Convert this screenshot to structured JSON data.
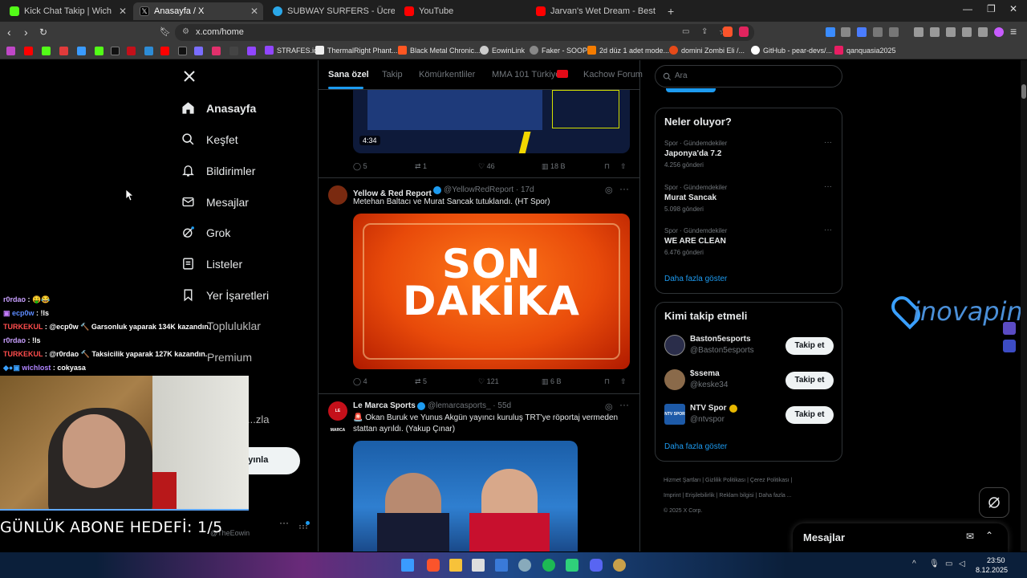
{
  "browser": {
    "tabs": [
      {
        "label": "Kick Chat Takip | Wich",
        "color": "#53fc18",
        "active": false
      },
      {
        "label": "Anasayfa / X",
        "color": "#000000",
        "active": true
      },
      {
        "label": "SUBWAY SURFERS - Ücretsiz Online C",
        "color": "#2aa7e8",
        "active": false
      },
      {
        "label": "YouTube",
        "color": "#ff0000",
        "active": false
      },
      {
        "label": "Jarvan's Wet Dream - Best of LoL Stre",
        "color": "#ff0000",
        "active": false
      }
    ],
    "new_tab": "+",
    "url": "x.com/home",
    "bookmarks": [
      "STRAFES.io",
      "ThermalRight Phant...",
      "Black Metal Chronic...",
      "EowinLink",
      "Faker - SOOP",
      "2d düz 1 adet mode...",
      "domini Zombi Eli /...",
      "GitHub - pear-devs/...",
      "qanquasia2025"
    ]
  },
  "x": {
    "nav": [
      "Anasayfa",
      "Keşfet",
      "Bildirimler",
      "Mesajlar",
      "Grok",
      "Listeler",
      "Yer İşaretleri",
      "Topluluklar",
      "Premium",
      "...zla",
      "...ayınla"
    ],
    "feed_tabs": [
      "Sana özel",
      "Takip",
      "Kömürkentliler",
      "MMA 101 Türkiye",
      "Kachow Forum"
    ],
    "video_duration": "4:34",
    "post0_actions": {
      "replies": "5",
      "reposts": "1",
      "likes": "46",
      "views": "18 B"
    },
    "post1": {
      "name": "Yellow & Red Report",
      "handle": "@YellowRedReport · 17d",
      "text": "Metehan Baltacı ve Murat Sancak tutuklandı. (HT Spor)",
      "image_text_1": "SON",
      "image_text_2": "DAKİKA",
      "replies": "4",
      "reposts": "5",
      "likes": "121",
      "views": "6 B"
    },
    "post2": {
      "name": "Le Marca Sports",
      "handle": "@lemarcasports_ · 55d",
      "avatar_text": "LE MARCA",
      "text": "🚨 Okan Buruk ve Yunus Akgün yayıncı kuruluş TRT'ye röportaj vermeden stattan ayrıldı. (Yakup Çınar)"
    },
    "search_placeholder": "Ara",
    "trends": {
      "title": "Neler oluyor?",
      "items": [
        {
          "category": "Spor · Gündemdekiler",
          "title": "Japonya'da 7.2",
          "count": "4.256 gönderi"
        },
        {
          "category": "Spor · Gündemdekiler",
          "title": "Murat Sancak",
          "count": "5.098 gönderi"
        },
        {
          "category": "Spor · Gündemdekiler",
          "title": "WE ARE CLEAN",
          "count": "6.476 gönderi"
        }
      ],
      "more": "Daha fazla göster"
    },
    "who_to_follow": {
      "title": "Kimi takip etmeli",
      "items": [
        {
          "name": "Baston5esports",
          "handle": "@Baston5esports",
          "button": "Takip et"
        },
        {
          "name": "$ssema",
          "handle": "@keske34",
          "button": "Takip et"
        },
        {
          "name": "NTV Spor",
          "handle": "@ntvspor",
          "avatar_text": "NTV SPOR",
          "button": "Takip et"
        }
      ],
      "more": "Daha fazla göster"
    },
    "footer": [
      "Hizmet Şartları",
      "Gizlilik Politikası",
      "Çerez Politikası",
      "Imprint",
      "Erişilebilirlik",
      "Reklam bilgisi",
      "Daha fazla ...",
      "© 2025 X Corp."
    ],
    "messages_title": "Mesajlar",
    "profile_handle": "@TheEowin"
  },
  "stream": {
    "chat": [
      {
        "user": "r0rdao",
        "msg": " : 🤑😂",
        "color": "#c9a0ff"
      },
      {
        "user": "ecp0w",
        "msg": " : !ls",
        "color": "#5d8bff"
      },
      {
        "user": "TURKEKUL",
        "msg": " : @ecp0w 🔨 Garsonluk yaparak 134K kazandın.",
        "color": "#ff4d4d"
      },
      {
        "user": "r0rdao",
        "msg": " : !ls",
        "color": "#c9a0ff"
      },
      {
        "user": "TURKEKUL",
        "msg": " : @r0rdao 🔨 Taksicilik yaparak 127K kazandın.",
        "color": "#ff4d4d"
      },
      {
        "user": "wichlost",
        "msg": " : cokyasa",
        "color": "#b084ff"
      }
    ],
    "goal": "GÜNLÜK ABONE HEDEFİ: 1/5",
    "watermark": "inovapin"
  },
  "taskbar": {
    "time": "23:50",
    "date": "8.12.2025"
  }
}
